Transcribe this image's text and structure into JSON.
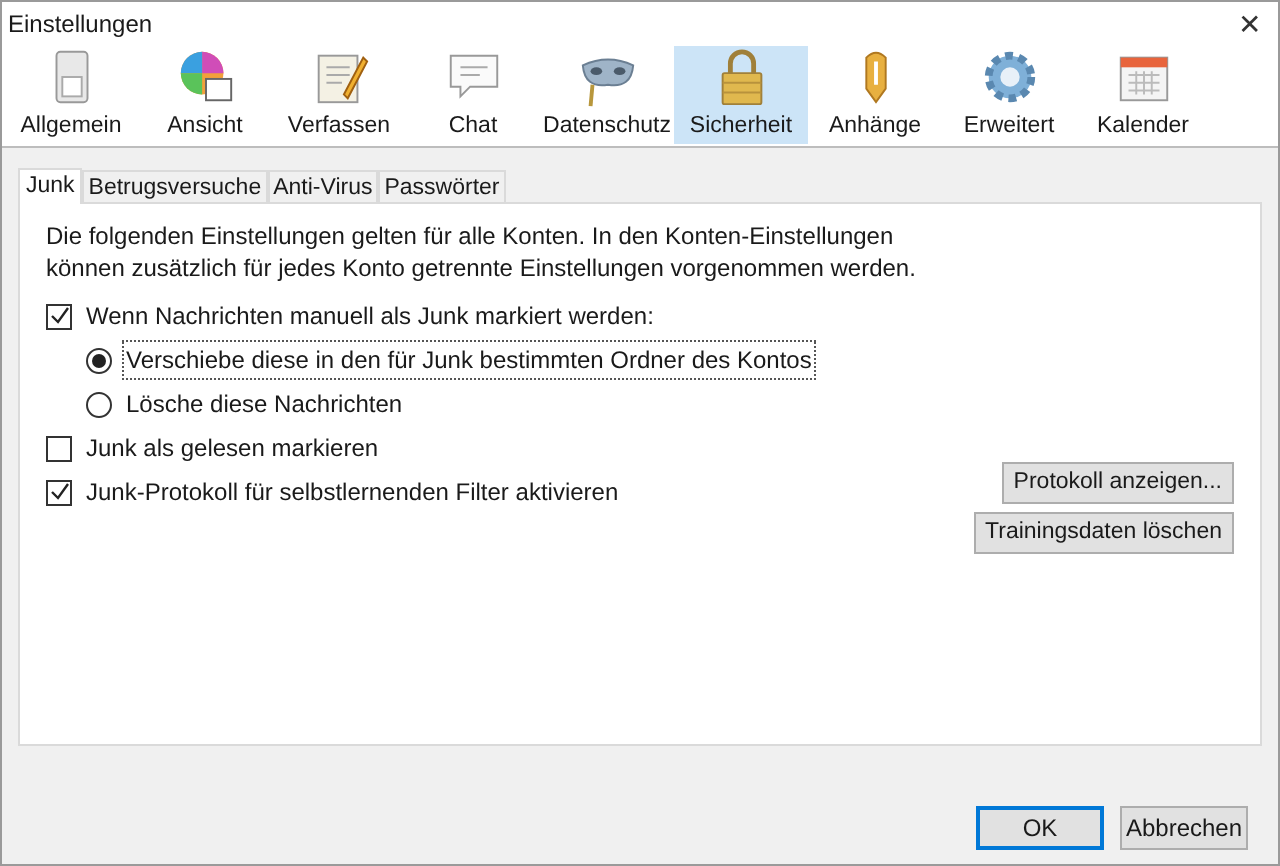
{
  "window": {
    "title": "Einstellungen",
    "close": "✕"
  },
  "toolbar": [
    {
      "label": "Allgemein",
      "selected": false
    },
    {
      "label": "Ansicht",
      "selected": false
    },
    {
      "label": "Verfassen",
      "selected": false
    },
    {
      "label": "Chat",
      "selected": false
    },
    {
      "label": "Datenschutz",
      "selected": false
    },
    {
      "label": "Sicherheit",
      "selected": true
    },
    {
      "label": "Anhänge",
      "selected": false
    },
    {
      "label": "Erweitert",
      "selected": false
    },
    {
      "label": "Kalender",
      "selected": false
    }
  ],
  "tabs": [
    {
      "label": "Junk",
      "selected": true
    },
    {
      "label": "Betrugsversuche",
      "selected": false
    },
    {
      "label": "Anti-Virus",
      "selected": false
    },
    {
      "label": "Passwörter",
      "selected": false
    }
  ],
  "description": "Die folgenden Einstellungen gelten für alle Konten. In den Konten-Einstellungen können zusätzlich für jedes Konto getrennte Einstellungen vorgenommen werden.",
  "options": [
    {
      "kind": "checkbox",
      "label": "Wenn Nachrichten manuell als Junk markiert werden:",
      "checked": true,
      "children": [
        {
          "kind": "radio",
          "label": "Verschiebe diese in den für Junk bestimmten Ordner des Kontos",
          "selected": true,
          "focused": true
        },
        {
          "kind": "radio",
          "label": "Lösche diese Nachrichten",
          "selected": false,
          "focused": false
        }
      ]
    },
    {
      "kind": "checkbox",
      "label": "Junk als gelesen markieren",
      "checked": false
    },
    {
      "kind": "checkbox",
      "label": "Junk-Protokoll für selbstlernenden Filter aktivieren",
      "checked": true
    }
  ],
  "side_buttons": [
    "Protokoll anzeigen...",
    "Trainingsdaten löschen"
  ],
  "buttons": [
    {
      "label": "OK",
      "default": true
    },
    {
      "label": "Abbrechen",
      "default": false
    }
  ]
}
